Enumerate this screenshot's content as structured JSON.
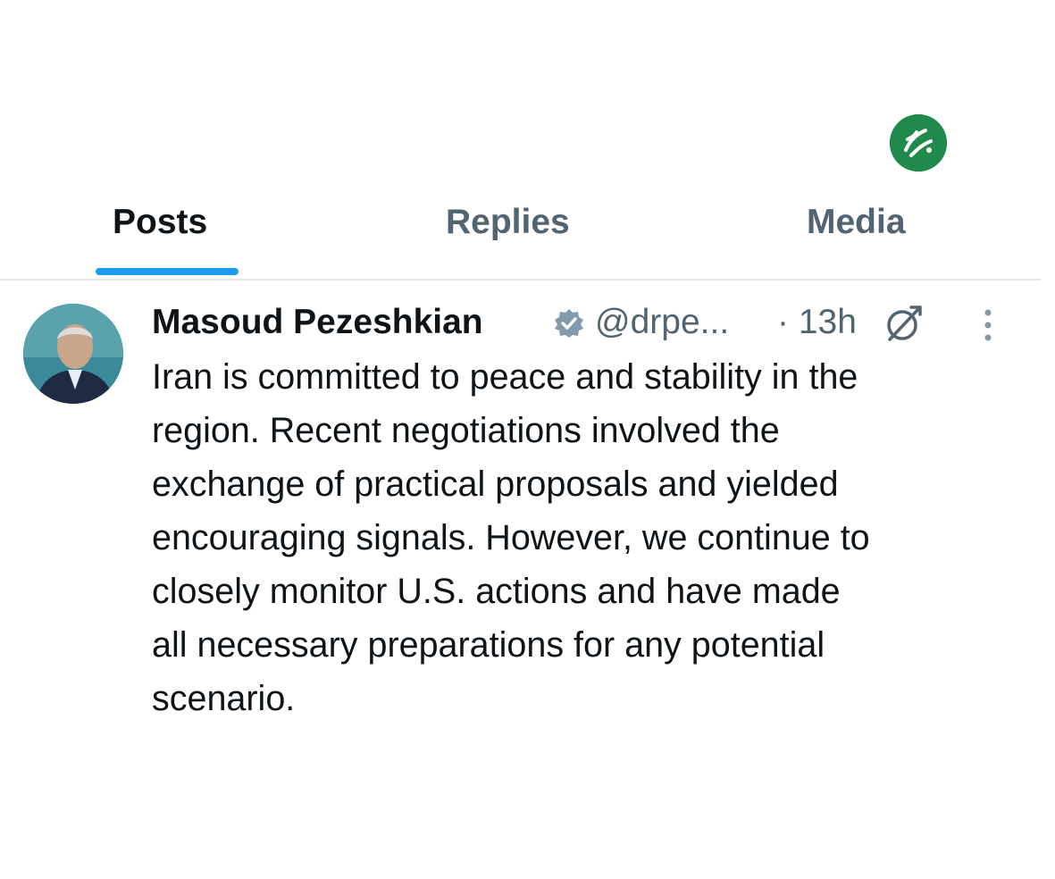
{
  "watermark": {
    "icon": "green-circle-logo",
    "color": "#1f8a4c"
  },
  "tabs": [
    {
      "label": "Posts",
      "active": true
    },
    {
      "label": "Replies",
      "active": false
    },
    {
      "label": "Media",
      "active": false
    }
  ],
  "colors": {
    "accent": "#1d9bf0",
    "text_primary": "#0f1419",
    "text_secondary": "#536471"
  },
  "post": {
    "author_name": "Masoud Pezeshkian",
    "verified_icon": "verified-badge-icon",
    "handle": "@drpe...",
    "time": "· 13h",
    "text_lines": [
      "Iran is committed to peace and stability in the",
      "region. Recent negotiations involved the",
      "exchange of practical proposals and yielded",
      "encouraging signals. However, we continue to",
      "closely monitor U.S. actions and have made",
      "all necessary preparations for any potential",
      "scenario."
    ]
  }
}
